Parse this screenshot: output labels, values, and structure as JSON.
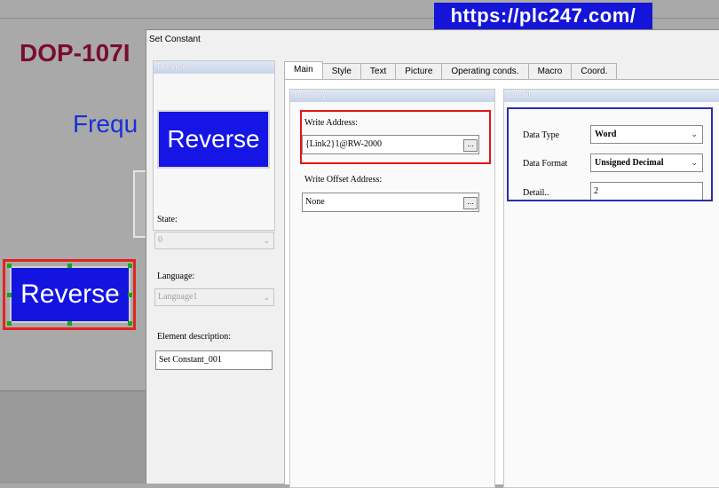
{
  "background": {
    "model_title": "DOP-107I",
    "freq_text": "Frequ",
    "canvas_button_label": "Reverse",
    "url_banner": "https://plc247.com/"
  },
  "dialog": {
    "title": "Set Constant",
    "preview": {
      "header": "Preview",
      "button_label": "Reverse"
    },
    "state": {
      "label": "State:",
      "value": "0"
    },
    "language": {
      "label": "Language:",
      "value": "Language1"
    },
    "element_description": {
      "label": "Element description:",
      "value": "Set Constant_001"
    },
    "tabs": [
      "Main",
      "Style",
      "Text",
      "Picture",
      "Operating conds.",
      "Macro",
      "Coord."
    ],
    "active_tab": "Main",
    "memory": {
      "header": "Memory",
      "write_address_label": "Write Address:",
      "write_address_value": "{Link2}1@RW-2000",
      "write_offset_label": "Write Offset Address:",
      "write_offset_value": "None",
      "browse_label": "..."
    },
    "detail": {
      "header": "Detail",
      "data_type_label": "Data Type",
      "data_type_value": "Word",
      "data_format_label": "Data Format",
      "data_format_value": "Unsigned Decimal",
      "detail_label": "Detail..",
      "detail_value": "2"
    }
  },
  "colors": {
    "highlight_red": "#e0161b",
    "highlight_blue": "#2c2cb0",
    "button_blue": "#1515e6",
    "title_maroon": "#7a0d2e"
  }
}
